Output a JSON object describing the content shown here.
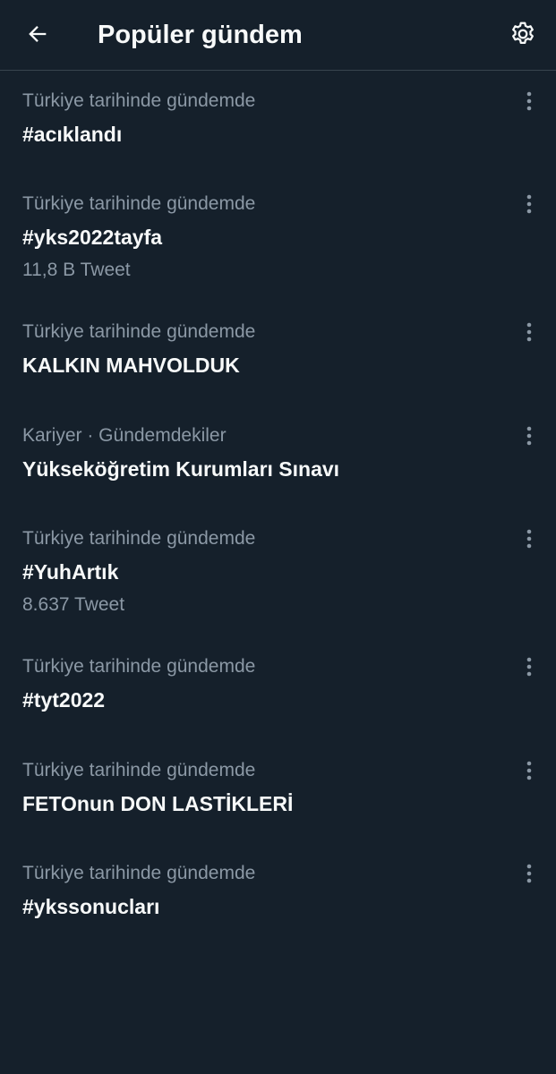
{
  "header": {
    "title": "Popüler gündem",
    "back_icon": "arrow-left-icon",
    "settings_icon": "gear-icon"
  },
  "trends": [
    {
      "context": "Türkiye tarihinde gündemde",
      "name": "#acıklandı",
      "count": ""
    },
    {
      "context": "Türkiye tarihinde gündemde",
      "name": "#yks2022tayfa",
      "count": "11,8 B Tweet"
    },
    {
      "context": "Türkiye tarihinde gündemde",
      "name": "KALKIN MAHVOLDUK",
      "count": ""
    },
    {
      "context": "Kariyer · Gündemdekiler",
      "name": "Yükseköğretim Kurumları Sınavı",
      "count": ""
    },
    {
      "context": "Türkiye tarihinde gündemde",
      "name": "#YuhArtık",
      "count": "8.637 Tweet"
    },
    {
      "context": "Türkiye tarihinde gündemde",
      "name": "#tyt2022",
      "count": ""
    },
    {
      "context": "Türkiye tarihinde gündemde",
      "name": "FETOnun DON LASTİKLERİ",
      "count": ""
    },
    {
      "context": "Türkiye tarihinde gündemde",
      "name": "#ykssonucları",
      "count": ""
    }
  ],
  "colors": {
    "background": "#15202b",
    "primary_text": "#f7f9f9",
    "secondary_text": "#8b98a5",
    "divider": "#38444d"
  }
}
